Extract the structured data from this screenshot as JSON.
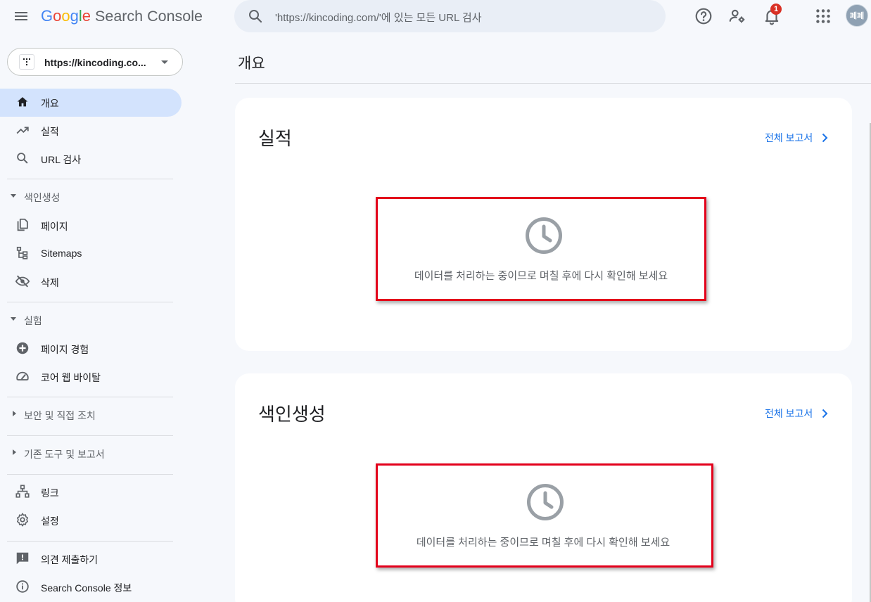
{
  "header": {
    "logo_letters": [
      {
        "ch": "G",
        "color": "#4285F4"
      },
      {
        "ch": "o",
        "color": "#EA4335"
      },
      {
        "ch": "o",
        "color": "#FBBC05"
      },
      {
        "ch": "g",
        "color": "#4285F4"
      },
      {
        "ch": "l",
        "color": "#34A853"
      },
      {
        "ch": "e",
        "color": "#EA4335"
      }
    ],
    "logo_google": "Google",
    "product_name": "Search Console",
    "search_placeholder": "'https://kincoding.com/'에 있는 모든 URL 검사",
    "notification_count": "1",
    "avatar_text": "페페",
    "icons": [
      "menu-icon",
      "search-icon",
      "help-icon",
      "manage-users-icon",
      "notifications-icon",
      "apps-icon"
    ]
  },
  "sidebar": {
    "property_url": "https://kincoding.co...",
    "items_top": [
      {
        "label": "개요",
        "icon": "home-icon",
        "active": true
      },
      {
        "label": "실적",
        "icon": "trending-icon"
      },
      {
        "label": "URL 검사",
        "icon": "search-icon"
      }
    ],
    "section_indexing": "색인생성",
    "items_indexing": [
      {
        "label": "페이지",
        "icon": "pages-icon"
      },
      {
        "label": "Sitemaps",
        "icon": "sitemap-icon"
      },
      {
        "label": "삭제",
        "icon": "visibility-off-icon"
      }
    ],
    "section_experience": "실험",
    "items_experience": [
      {
        "label": "페이지 경험",
        "icon": "add-circle-icon"
      },
      {
        "label": "코어 웹 바이탈",
        "icon": "speed-icon"
      }
    ],
    "section_security": "보안 및 직접 조치",
    "section_legacy": "기존 도구 및 보고서",
    "items_bottom": [
      {
        "label": "링크",
        "icon": "links-icon"
      },
      {
        "label": "설정",
        "icon": "settings-icon"
      }
    ],
    "items_footer": [
      {
        "label": "의견 제출하기",
        "icon": "feedback-icon"
      },
      {
        "label": "Search Console 정보",
        "icon": "info-icon"
      }
    ]
  },
  "main": {
    "page_title": "개요",
    "cards": [
      {
        "title": "실적",
        "link": "전체 보고서",
        "message": "데이터를 처리하는 중이므로 며칠 후에 다시 확인해 보세요"
      },
      {
        "title": "색인생성",
        "link": "전체 보고서",
        "message": "데이터를 처리하는 중이므로 며칠 후에 다시 확인해 보세요"
      }
    ]
  },
  "colors": {
    "accent": "#1a73e8",
    "active_nav_bg": "#d3e3fd",
    "highlight_border": "#e3001b",
    "background": "#f6f8fc"
  }
}
